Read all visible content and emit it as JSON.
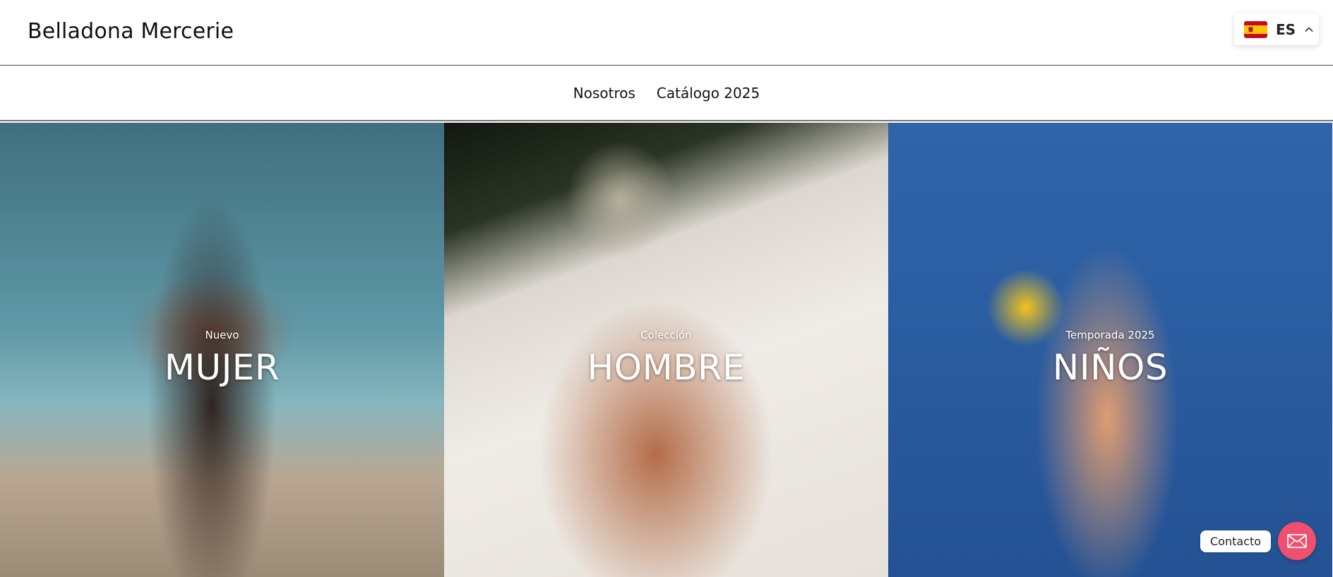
{
  "header": {
    "brand": "Belladona Mercerie",
    "language": {
      "code": "ES",
      "flag_icon": "spain-flag-icon"
    }
  },
  "nav": {
    "items": [
      {
        "label": "Nosotros"
      },
      {
        "label": "Catálogo 2025"
      }
    ]
  },
  "panels": [
    {
      "eyebrow": "Nuevo",
      "title": "MUJER"
    },
    {
      "eyebrow": "Colección",
      "title": "HOMBRE"
    },
    {
      "eyebrow": "Temporada 2025",
      "title": "NIÑOS"
    }
  ],
  "contact": {
    "label": "Contacto",
    "icon": "envelope-icon",
    "accent": "#f0506e"
  }
}
